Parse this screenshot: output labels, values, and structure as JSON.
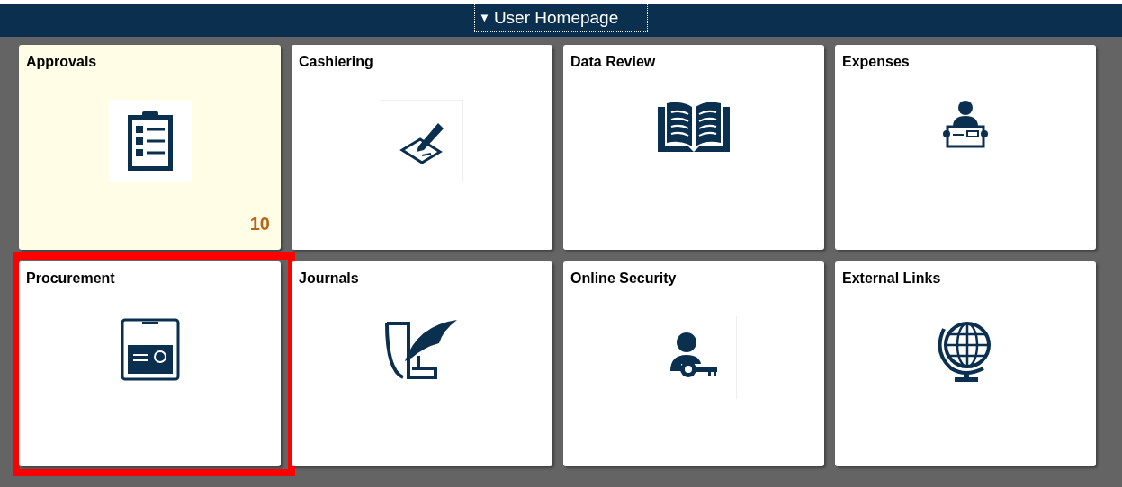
{
  "header": {
    "title": "User Homepage",
    "caret": "▼"
  },
  "tiles": [
    {
      "label": "Approvals",
      "kind": "clipboard",
      "badge": "10",
      "highlighted": true,
      "outlined": false
    },
    {
      "label": "Cashiering",
      "kind": "signing",
      "highlighted": false,
      "outlined": false
    },
    {
      "label": "Data Review",
      "kind": "book",
      "highlighted": false,
      "outlined": false
    },
    {
      "label": "Expenses",
      "kind": "person-card",
      "highlighted": false,
      "outlined": false
    },
    {
      "label": "Procurement",
      "kind": "payment-card",
      "highlighted": false,
      "outlined": true
    },
    {
      "label": "Journals",
      "kind": "quill",
      "highlighted": false,
      "outlined": false
    },
    {
      "label": "Online Security",
      "kind": "person-key",
      "highlighted": false,
      "outlined": false
    },
    {
      "label": "External Links",
      "kind": "globe",
      "highlighted": false,
      "outlined": false
    }
  ]
}
